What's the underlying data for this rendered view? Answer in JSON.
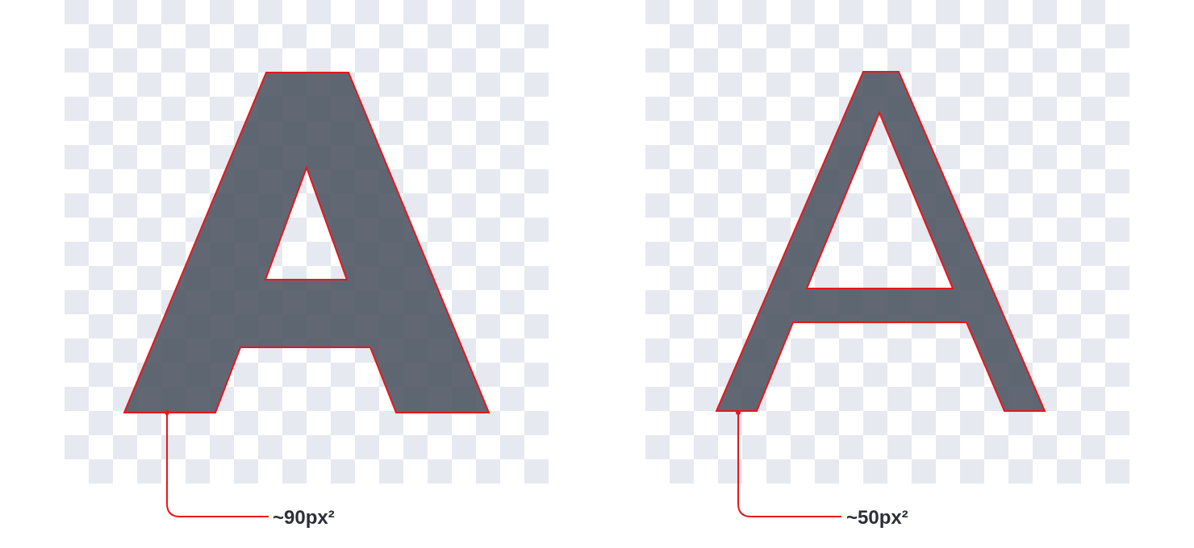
{
  "colors": {
    "checker_light": "#ffffff",
    "checker_dark": "#e6e9ef",
    "glyph_fill": "#4b5361",
    "glyph_fill_opacity": 0.88,
    "outline": "#e8161c",
    "label_text": "#2b2f36"
  },
  "panels": [
    {
      "label": "~90px²",
      "glyph": "bold-letter-a"
    },
    {
      "label": "~50px²",
      "glyph": "thin-letter-a"
    }
  ]
}
